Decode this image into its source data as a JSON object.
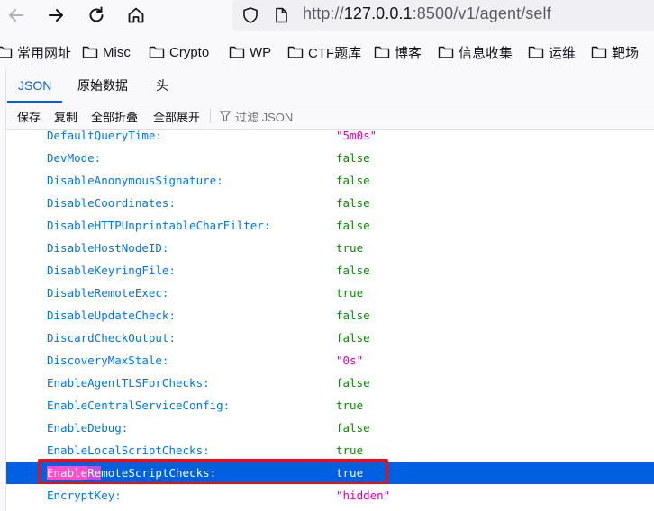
{
  "browser": {
    "url_prefix": "http://",
    "url_host": "127.0.0.1",
    "url_rest": ":8500/v1/agent/self",
    "bookmarks": [
      "常用网址",
      "Misc",
      "Crypto",
      "WP",
      "CTF题库",
      "博客",
      "信息收集",
      "运维",
      "靶场"
    ]
  },
  "viewer": {
    "tabs": [
      "JSON",
      "原始数据",
      "头"
    ],
    "toolbar": {
      "save": "保存",
      "copy": "复制",
      "collapse_all": "全部折叠",
      "expand_all": "全部展开",
      "filter_placeholder": "过滤 JSON"
    },
    "rows": [
      {
        "key": "DefaultQueryTime:",
        "value": "\"5m0s\"",
        "type": "str"
      },
      {
        "key": "DevMode:",
        "value": "false",
        "type": "bool"
      },
      {
        "key": "DisableAnonymousSignature:",
        "value": "false",
        "type": "bool"
      },
      {
        "key": "DisableCoordinates:",
        "value": "false",
        "type": "bool"
      },
      {
        "key": "DisableHTTPUnprintableCharFilter:",
        "value": "false",
        "type": "bool"
      },
      {
        "key": "DisableHostNodeID:",
        "value": "true",
        "type": "bool"
      },
      {
        "key": "DisableKeyringFile:",
        "value": "false",
        "type": "bool"
      },
      {
        "key": "DisableRemoteExec:",
        "value": "true",
        "type": "bool"
      },
      {
        "key": "DisableUpdateCheck:",
        "value": "false",
        "type": "bool"
      },
      {
        "key": "DiscardCheckOutput:",
        "value": "false",
        "type": "bool"
      },
      {
        "key": "DiscoveryMaxStale:",
        "value": "\"0s\"",
        "type": "str"
      },
      {
        "key": "EnableAgentTLSForChecks:",
        "value": "false",
        "type": "bool"
      },
      {
        "key": "EnableCentralServiceConfig:",
        "value": "true",
        "type": "bool"
      },
      {
        "key": "EnableDebug:",
        "value": "false",
        "type": "bool"
      },
      {
        "key": "EnableLocalScriptChecks:",
        "value": "true",
        "type": "bool"
      },
      {
        "key_hl1": "Enable",
        "key_hl2": "Re",
        "key_rest": "moteScriptChecks:",
        "value": "true",
        "type": "bool",
        "selected": true
      },
      {
        "key": "EncryptKey:",
        "value": "\"hidden\"",
        "type": "str"
      }
    ]
  },
  "colors": {
    "accent": "#0060df",
    "key": "#0074e8",
    "bool": "#058b00",
    "string": "#dd00a9",
    "annotation": "#e8101a"
  }
}
